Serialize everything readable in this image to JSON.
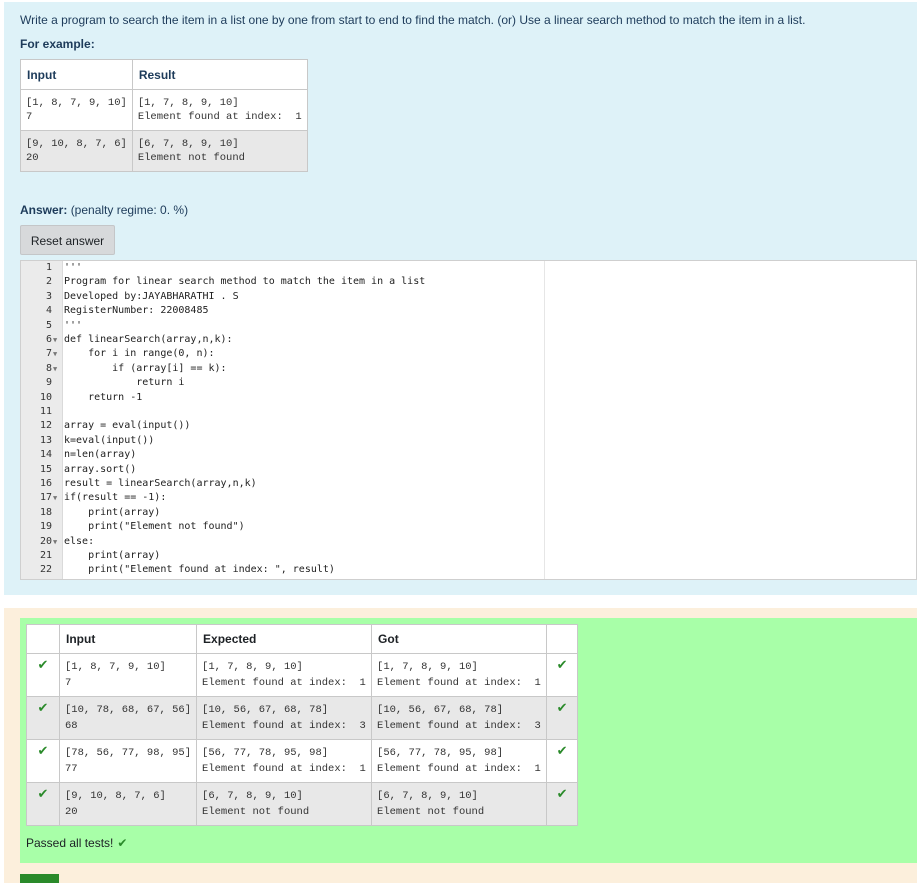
{
  "question": {
    "text": "Write a program to search the item in a list one by one from start to end to find the match. (or) Use a linear search method to match the item in a list.",
    "for_example": "For example:",
    "examples_headers": [
      "Input",
      "Result"
    ],
    "examples": [
      {
        "input": "[1, 8, 7, 9, 10]\n7",
        "result": "[1, 7, 8, 9, 10]\nElement found at index:  1"
      },
      {
        "input": "[9, 10, 8, 7, 6]\n20",
        "result": "[6, 7, 8, 9, 10]\nElement not found"
      }
    ]
  },
  "answer": {
    "label": "Answer:",
    "penalty": "(penalty regime: 0. %)",
    "reset_label": "Reset answer"
  },
  "editor": {
    "lines": [
      "'''",
      "Program for linear search method to match the item in a list",
      "Developed by:JAYABHARATHI . S",
      "RegisterNumber: 22008485",
      "'''",
      "def linearSearch(array,n,k):",
      "    for i in range(0, n):",
      "        if (array[i] == k):",
      "            return i",
      "    return -1",
      "",
      "array = eval(input())",
      "k=eval(input())",
      "n=len(array)",
      "array.sort()",
      "result = linearSearch(array,n,k)",
      "if(result == -1):",
      "    print(array)",
      "    print(\"Element not found\")",
      "else:",
      "    print(array)",
      "    print(\"Element found at index: \", result)"
    ],
    "fold_lines": [
      6,
      7,
      8,
      17,
      20
    ]
  },
  "results": {
    "headers": [
      "",
      "Input",
      "Expected",
      "Got",
      ""
    ],
    "rows": [
      {
        "input": "[1, 8, 7, 9, 10]\n7",
        "expected": "[1, 7, 8, 9, 10]\nElement found at index:  1",
        "got": "[1, 7, 8, 9, 10]\nElement found at index:  1"
      },
      {
        "input": "[10, 78, 68, 67, 56]\n68",
        "expected": "[10, 56, 67, 68, 78]\nElement found at index:  3",
        "got": "[10, 56, 67, 68, 78]\nElement found at index:  3"
      },
      {
        "input": "[78, 56, 77, 98, 95]\n77",
        "expected": "[56, 77, 78, 95, 98]\nElement found at index:  1",
        "got": "[56, 77, 78, 95, 98]\nElement found at index:  1"
      },
      {
        "input": "[9, 10, 8, 7, 6]\n20",
        "expected": "[6, 7, 8, 9, 10]\nElement not found",
        "got": "[6, 7, 8, 9, 10]\nElement not found"
      }
    ],
    "passed": "Passed all tests!"
  },
  "colors": {
    "question_bg": "#def2f8",
    "result_bg": "#fcefdc",
    "pass_bg": "#a8ffa8",
    "tick": "#2a8a2a"
  },
  "icons": {
    "pass": "check-icon"
  }
}
